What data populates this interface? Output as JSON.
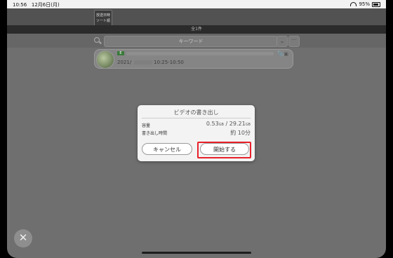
{
  "status_bar": {
    "time": "10:56",
    "date": "12月6日(月)",
    "battery": "95%"
  },
  "toolbar": {
    "sort_line1": "放送日時",
    "sort_line2": "ソート順"
  },
  "list": {
    "count": "全1件"
  },
  "search": {
    "placeholder": "キーワード"
  },
  "recording": {
    "channel_badge": "E",
    "date_prefix": "2021/",
    "time": "10:25-10:50"
  },
  "dialog": {
    "title": "ビデオの書き出し",
    "capacity_label": "容量",
    "capacity_value": "0.53",
    "capacity_unit": "GB",
    "capacity_sep": " / ",
    "capacity_total": "29.21",
    "capacity_total_unit": "GB",
    "time_label": "書き出し時間",
    "time_value": "約 10分",
    "cancel_label": "キャンセル",
    "start_label": "開始する"
  },
  "icons": {
    "close": "close-icon",
    "search": "search-icon",
    "dropdown": "chevron-down-icon",
    "more": "more-icon"
  }
}
